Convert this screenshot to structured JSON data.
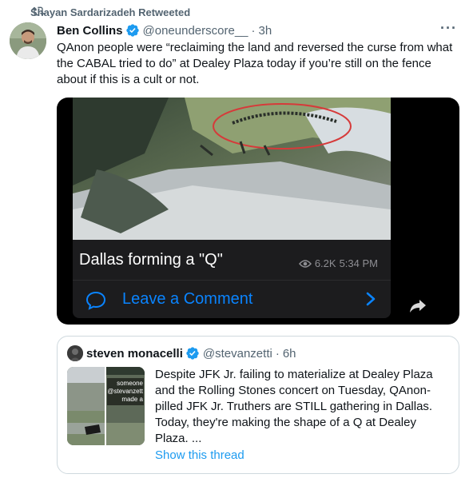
{
  "retweet": {
    "label": "Shayan Sardarizadeh Retweeted",
    "icon": "retweet-icon"
  },
  "tweet": {
    "author_name": "Ben Collins",
    "handle": "@oneunderscore__",
    "separator": "·",
    "time": "3h",
    "more_label": "···",
    "text": "QAnon people were “reclaiming the land and reversed the curse from what the CABAL tried to do” at Dealey Plaza today if you’re still on the fence about if this is a cult or not.",
    "verified_color": "#1d9bf0"
  },
  "media": {
    "caption": "Dallas forming a \"Q\"",
    "views": "6.2K",
    "time": "5:34 PM",
    "comment_label": "Leave a Comment",
    "accent": "#0a84ff"
  },
  "quote": {
    "author_name": "steven monacelli",
    "handle": "@stevanzetti",
    "separator": "·",
    "time": "6h",
    "text": "Despite JFK Jr. failing to materialize at Dealey Plaza and the Rolling Stones concert on Tuesday, QAnon-pilled JFK Jr. Truthers are STILL gathering in Dallas. Today, they're making the shape of a Q at Dealey Plaza. ...",
    "show_thread": "Show this thread",
    "thumb_text_1": "someone",
    "thumb_text_2": "@stevanzett",
    "thumb_text_3": "made a",
    "link_color": "#1d9bf0"
  }
}
